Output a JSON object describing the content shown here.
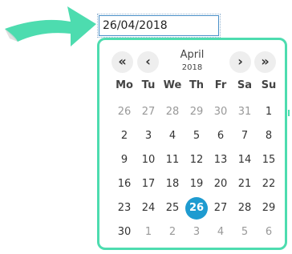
{
  "input": {
    "value": "26/04/2018"
  },
  "picker": {
    "month": "April",
    "year": "2018",
    "nav": {
      "prev_year": "«",
      "prev_month": "‹",
      "next_month": "›",
      "next_year": "»"
    },
    "weekdays": [
      "Mo",
      "Tu",
      "We",
      "Th",
      "Fr",
      "Sa",
      "Su"
    ],
    "weeks": [
      [
        {
          "d": "26",
          "o": true
        },
        {
          "d": "27",
          "o": true
        },
        {
          "d": "28",
          "o": true
        },
        {
          "d": "29",
          "o": true
        },
        {
          "d": "30",
          "o": true
        },
        {
          "d": "31",
          "o": true
        },
        {
          "d": "1",
          "o": false
        }
      ],
      [
        {
          "d": "2",
          "o": false
        },
        {
          "d": "3",
          "o": false
        },
        {
          "d": "4",
          "o": false
        },
        {
          "d": "5",
          "o": false
        },
        {
          "d": "6",
          "o": false
        },
        {
          "d": "7",
          "o": false
        },
        {
          "d": "8",
          "o": false
        }
      ],
      [
        {
          "d": "9",
          "o": false
        },
        {
          "d": "10",
          "o": false
        },
        {
          "d": "11",
          "o": false
        },
        {
          "d": "12",
          "o": false
        },
        {
          "d": "13",
          "o": false
        },
        {
          "d": "14",
          "o": false
        },
        {
          "d": "15",
          "o": false
        }
      ],
      [
        {
          "d": "16",
          "o": false
        },
        {
          "d": "17",
          "o": false
        },
        {
          "d": "18",
          "o": false
        },
        {
          "d": "19",
          "o": false
        },
        {
          "d": "20",
          "o": false
        },
        {
          "d": "21",
          "o": false
        },
        {
          "d": "22",
          "o": false
        }
      ],
      [
        {
          "d": "23",
          "o": false
        },
        {
          "d": "24",
          "o": false
        },
        {
          "d": "25",
          "o": false
        },
        {
          "d": "26",
          "o": false,
          "selected": true
        },
        {
          "d": "27",
          "o": false
        },
        {
          "d": "28",
          "o": false
        },
        {
          "d": "29",
          "o": false
        }
      ],
      [
        {
          "d": "30",
          "o": false
        },
        {
          "d": "1",
          "o": true
        },
        {
          "d": "2",
          "o": true
        },
        {
          "d": "3",
          "o": true
        },
        {
          "d": "4",
          "o": true
        },
        {
          "d": "5",
          "o": true
        },
        {
          "d": "6",
          "o": true
        }
      ]
    ]
  },
  "colors": {
    "accent": "#4ddcaf",
    "selected": "#1e9bd0",
    "nav_bg": "#eeeeee",
    "other_month_text": "#999999"
  },
  "icons": {
    "pointer": "arrow-icon"
  }
}
